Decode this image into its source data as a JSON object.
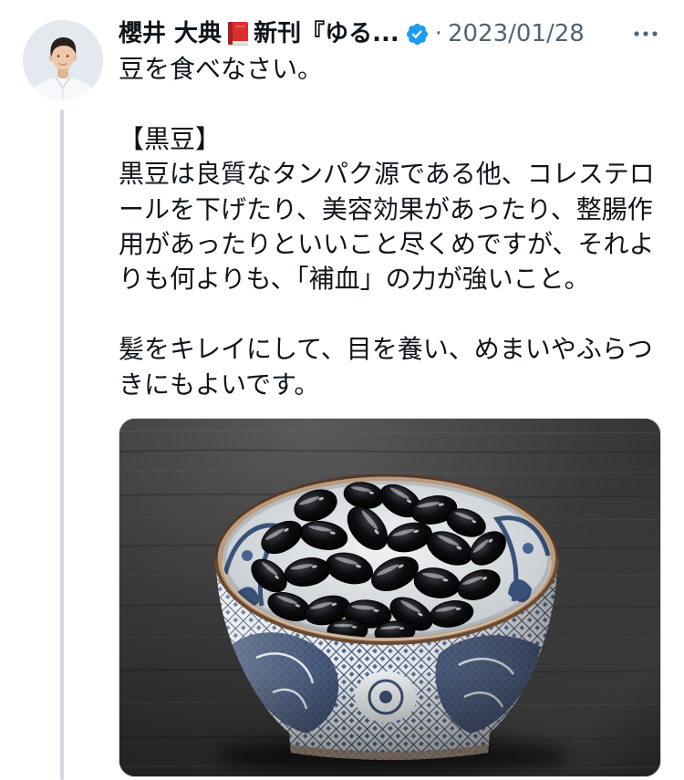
{
  "tweet": {
    "author": {
      "name_before_emoji": "櫻井 大典",
      "emoji_icon": "red-book-icon",
      "name_after_emoji": "新刊『ゆる...",
      "verified": true,
      "verified_icon": "verified-badge-icon"
    },
    "separator": "·",
    "date": "2023/01/28",
    "more_icon": "more-icon",
    "paragraphs": [
      [
        "豆を食べなさい。"
      ],
      [
        "【黒豆】",
        "黒豆は良質なタンパク源である他、コレステロ",
        "ールを下げたり、美容効果があったり、整腸作",
        "用があったりといいこと尽くめですが、それよ",
        "りも何よりも、「補血」の力が強いこと。"
      ],
      [
        "髪をキレイにして、目を養い、めまいやふらつ",
        "きにもよいです。"
      ]
    ]
  },
  "colors": {
    "text": "#0f1419",
    "secondary_text": "#536471",
    "accent": "#1d9bf0",
    "thread_line": "#cfd9de",
    "background": "#ffffff"
  }
}
